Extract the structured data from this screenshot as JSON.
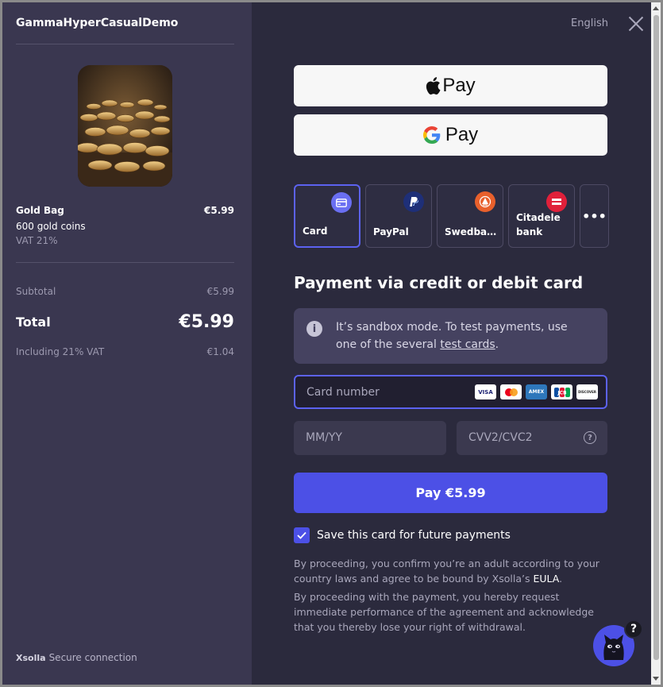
{
  "store": {
    "title": "GammaHyperCasualDemo"
  },
  "product": {
    "name": "Gold Bag",
    "price": "€5.99",
    "description": "600 gold coins",
    "vat": "VAT 21%"
  },
  "summary": {
    "subtotal_label": "Subtotal",
    "subtotal_value": "€5.99",
    "total_label": "Total",
    "total_value": "€5.99",
    "vat_label": "Including 21% VAT",
    "vat_value": "€1.04"
  },
  "footer": {
    "brand": "Xsolla",
    "secure_label": "Secure connection"
  },
  "header": {
    "language": "English"
  },
  "wallets": {
    "apple_pay": "Pay",
    "google_pay": "Pay"
  },
  "methods": [
    {
      "label": "Card",
      "icon": "card-icon",
      "color": "#6a6ff2"
    },
    {
      "label": "PayPal",
      "icon": "paypal-icon",
      "color": "#1e2f78"
    },
    {
      "label": "Swedba…",
      "icon": "swedbank-icon",
      "color": "#e8602c"
    },
    {
      "label": "Citadele bank",
      "icon": "citadele-icon",
      "color": "#e0203a"
    },
    {
      "label": "•••",
      "icon": "more-icon"
    }
  ],
  "payment": {
    "title": "Payment via credit or debit card",
    "info_text": "It’s sandbox mode. To test payments, use one of the several ",
    "info_link": "test cards",
    "info_end": ".",
    "card_placeholder": "Card number",
    "brands": [
      "VISA",
      "MC",
      "AMEX",
      "JCB",
      "DISCOVER"
    ],
    "expiry_placeholder": "MM/YY",
    "cvv_placeholder": "CVV2/CVC2",
    "pay_button": "Pay €5.99",
    "save_card_label": "Save this card for future payments",
    "save_card_checked": true
  },
  "legal": {
    "text1": "By proceeding, you confirm you’re an adult according to your country laws and agree to be bound by Xsolla’s ",
    "eula": "EULA",
    "text1_end": ".",
    "text2": "By proceeding with the payment, you hereby request immediate performance of the agreement and acknowledge that you thereby lose your right of withdrawal."
  },
  "support": {
    "badge": "?"
  },
  "colors": {
    "accent": "#4c50e6",
    "left_bg": "#3a3750",
    "right_bg": "#2b2a3d"
  }
}
